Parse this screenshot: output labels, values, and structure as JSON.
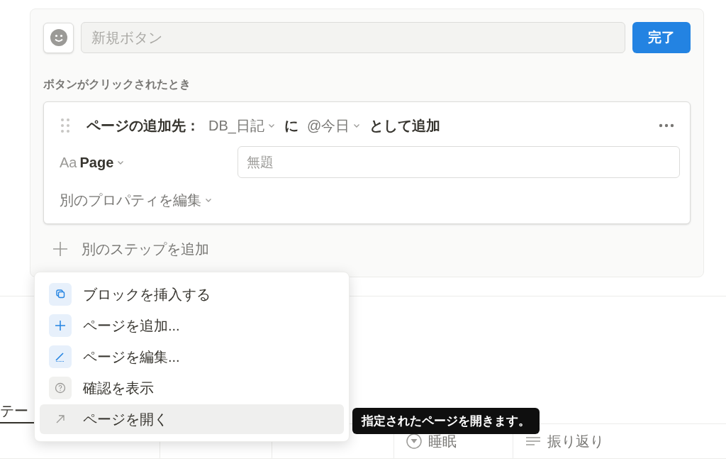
{
  "button_editor": {
    "name_field": {
      "placeholder": "新規ボタン"
    },
    "done_button": "完了",
    "trigger_label": "ボタンがクリックされたとき",
    "step": {
      "prefix": "ページの追加先：",
      "database": "DB_日記",
      "connector": "に",
      "date": "@今日",
      "suffix": "として追加",
      "property": {
        "type_icon": "Aa",
        "name": "Page",
        "placeholder": "無題"
      },
      "edit_properties": "別のプロパティを編集"
    },
    "add_step": "別のステップを追加"
  },
  "view_tab": {
    "label": "テー",
    "selected": true
  },
  "table": {
    "columns": [
      {
        "kind": "covered"
      },
      {
        "kind": "covered"
      },
      {
        "kind": "covered"
      },
      {
        "kind": "select",
        "label": "睡眠"
      },
      {
        "kind": "text",
        "label": "振り返り"
      }
    ]
  },
  "menu": {
    "items": [
      {
        "kind": "block",
        "label": "ブロックを挿入する",
        "selected": false
      },
      {
        "kind": "add",
        "label": "ページを追加...",
        "selected": false
      },
      {
        "kind": "edit",
        "label": "ページを編集...",
        "selected": false
      },
      {
        "kind": "confirm",
        "label": "確認を表示",
        "selected": false
      },
      {
        "kind": "open",
        "label": "ページを開く",
        "selected": true
      }
    ]
  },
  "tooltip": "指定されたページを開きます。"
}
